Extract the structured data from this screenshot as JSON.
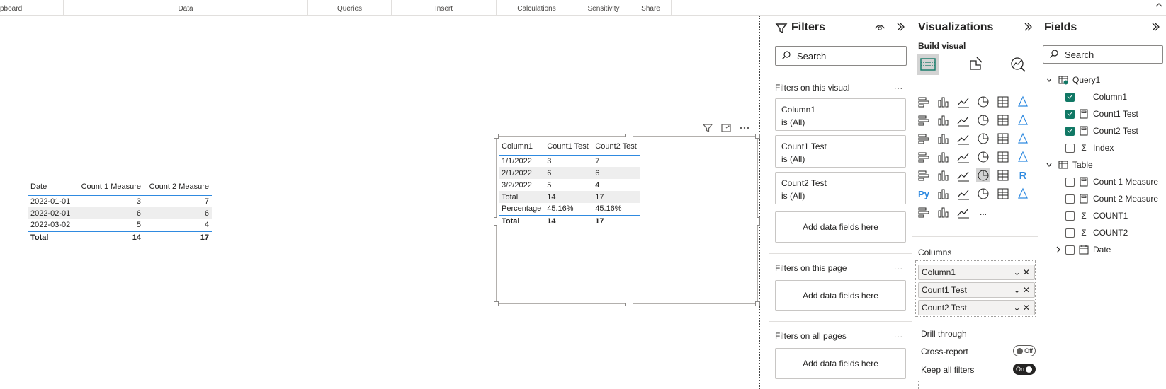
{
  "ribbon": {
    "groups": [
      "pboard",
      "Data",
      "Queries",
      "Insert",
      "Calculations",
      "Sensitivity",
      "Share"
    ]
  },
  "table_left": {
    "headers": [
      "Date",
      "Count 1 Measure",
      "Count 2 Measure"
    ],
    "rows": [
      [
        "2022-01-01",
        "3",
        "7"
      ],
      [
        "2022-02-01",
        "6",
        "6"
      ],
      [
        "2022-03-02",
        "5",
        "4"
      ]
    ],
    "total": [
      "Total",
      "14",
      "17"
    ]
  },
  "table_right": {
    "headers": [
      "Column1",
      "Count1 Test",
      "Count2 Test"
    ],
    "rows": [
      [
        "1/1/2022",
        "3",
        "7"
      ],
      [
        "2/1/2022",
        "6",
        "6"
      ],
      [
        "3/2/2022",
        "5",
        "4"
      ],
      [
        "Total",
        "14",
        "17"
      ],
      [
        "Percentage",
        "45.16%",
        "45.16%"
      ]
    ],
    "total": [
      "Total",
      "14",
      "17"
    ]
  },
  "filters": {
    "title": "Filters",
    "search_placeholder": "Search",
    "on_visual_label": "Filters on this visual",
    "cards": [
      {
        "field": "Column1",
        "state": "is (All)"
      },
      {
        "field": "Count1 Test",
        "state": "is (All)"
      },
      {
        "field": "Count2 Test",
        "state": "is (All)"
      }
    ],
    "add_label": "Add data fields here",
    "on_page_label": "Filters on this page",
    "on_all_label": "Filters on all pages"
  },
  "visualizations": {
    "title": "Visualizations",
    "build_label": "Build visual",
    "r_label": "R",
    "py_label": "Py",
    "more_label": "...",
    "columns_label": "Columns",
    "columns": [
      "Column1",
      "Count1 Test",
      "Count2 Test"
    ],
    "drill_label": "Drill through",
    "cross_report_label": "Cross-report",
    "cross_report_state": "Off",
    "keep_filters_label": "Keep all filters",
    "keep_filters_state": "On"
  },
  "fields": {
    "title": "Fields",
    "search_placeholder": "Search",
    "query1": "Query1",
    "query1_items": [
      {
        "name": "Column1",
        "checked": true
      },
      {
        "name": "Count1 Test",
        "checked": true
      },
      {
        "name": "Count2 Test",
        "checked": true
      },
      {
        "name": "Index",
        "checked": false
      }
    ],
    "table": "Table",
    "table_items": [
      {
        "name": "Count 1 Measure",
        "checked": false
      },
      {
        "name": "Count 2 Measure",
        "checked": false
      },
      {
        "name": "COUNT1",
        "checked": false
      },
      {
        "name": "COUNT2",
        "checked": false
      },
      {
        "name": "Date",
        "checked": false
      }
    ]
  },
  "colors": {
    "accent": "#2f8ae0",
    "check": "#117865"
  }
}
